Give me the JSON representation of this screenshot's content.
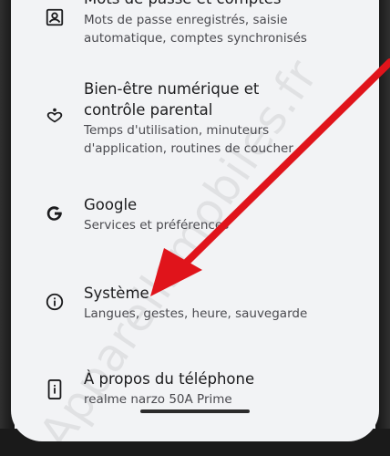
{
  "settings": {
    "items": [
      {
        "title": "Mots de passe et comptes",
        "subtitle": "Mots de passe enregistrés, saisie automatique, comptes synchronisés",
        "icon": "account-box-icon"
      },
      {
        "title": "Bien-être numérique et contrôle parental",
        "subtitle": "Temps d'utilisation, minuteurs d'application, routines de coucher",
        "icon": "digital-wellbeing-icon"
      },
      {
        "title": "Google",
        "subtitle": "Services et préférences",
        "icon": "google-icon"
      },
      {
        "title": "Système",
        "subtitle": "Langues, gestes, heure, sauvegarde",
        "icon": "info-icon"
      },
      {
        "title": "À propos du téléphone",
        "subtitle": "realme narzo 50A Prime",
        "icon": "phone-info-icon"
      }
    ]
  },
  "watermark": {
    "text": "Appareilsmobiles.fr"
  },
  "colors": {
    "arrow": "#e0141b",
    "background": "#f2f3f5",
    "text": "#1c1c1e"
  }
}
